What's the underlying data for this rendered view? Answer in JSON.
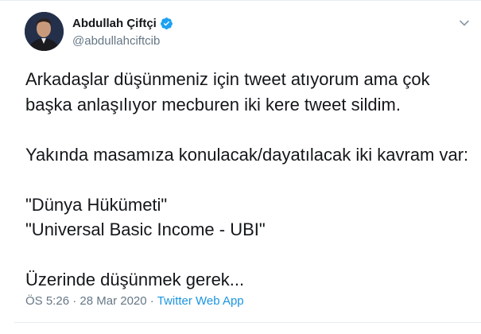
{
  "tweet": {
    "author": {
      "display_name": "Abdullah Çiftçi",
      "handle": "@abdullahciftcib",
      "verified": true
    },
    "text_lines": [
      "Arkadaşlar düşünmeniz için tweet atıyorum ama çok",
      "başka anlaşılıyor mecburen iki kere tweet sildim.",
      "",
      "Yakında masamıza konulacak/dayatılacak iki kavram var:",
      "",
      "\"Dünya Hükümeti\"",
      "\"Universal Basic Income - UBI\"",
      "",
      "Üzerinde düşünmek gerek..."
    ],
    "time": "ÖS 5:26",
    "separator": "·",
    "date": "28 Mar 2020",
    "source": "Twitter Web App"
  },
  "icons": {
    "verified": "verified-badge-icon",
    "menu": "chevron-down-icon"
  },
  "colors": {
    "verified_blue": "#1da1f2",
    "link_blue": "#1b95e0",
    "muted_gray": "#657786",
    "text": "#14171a"
  }
}
